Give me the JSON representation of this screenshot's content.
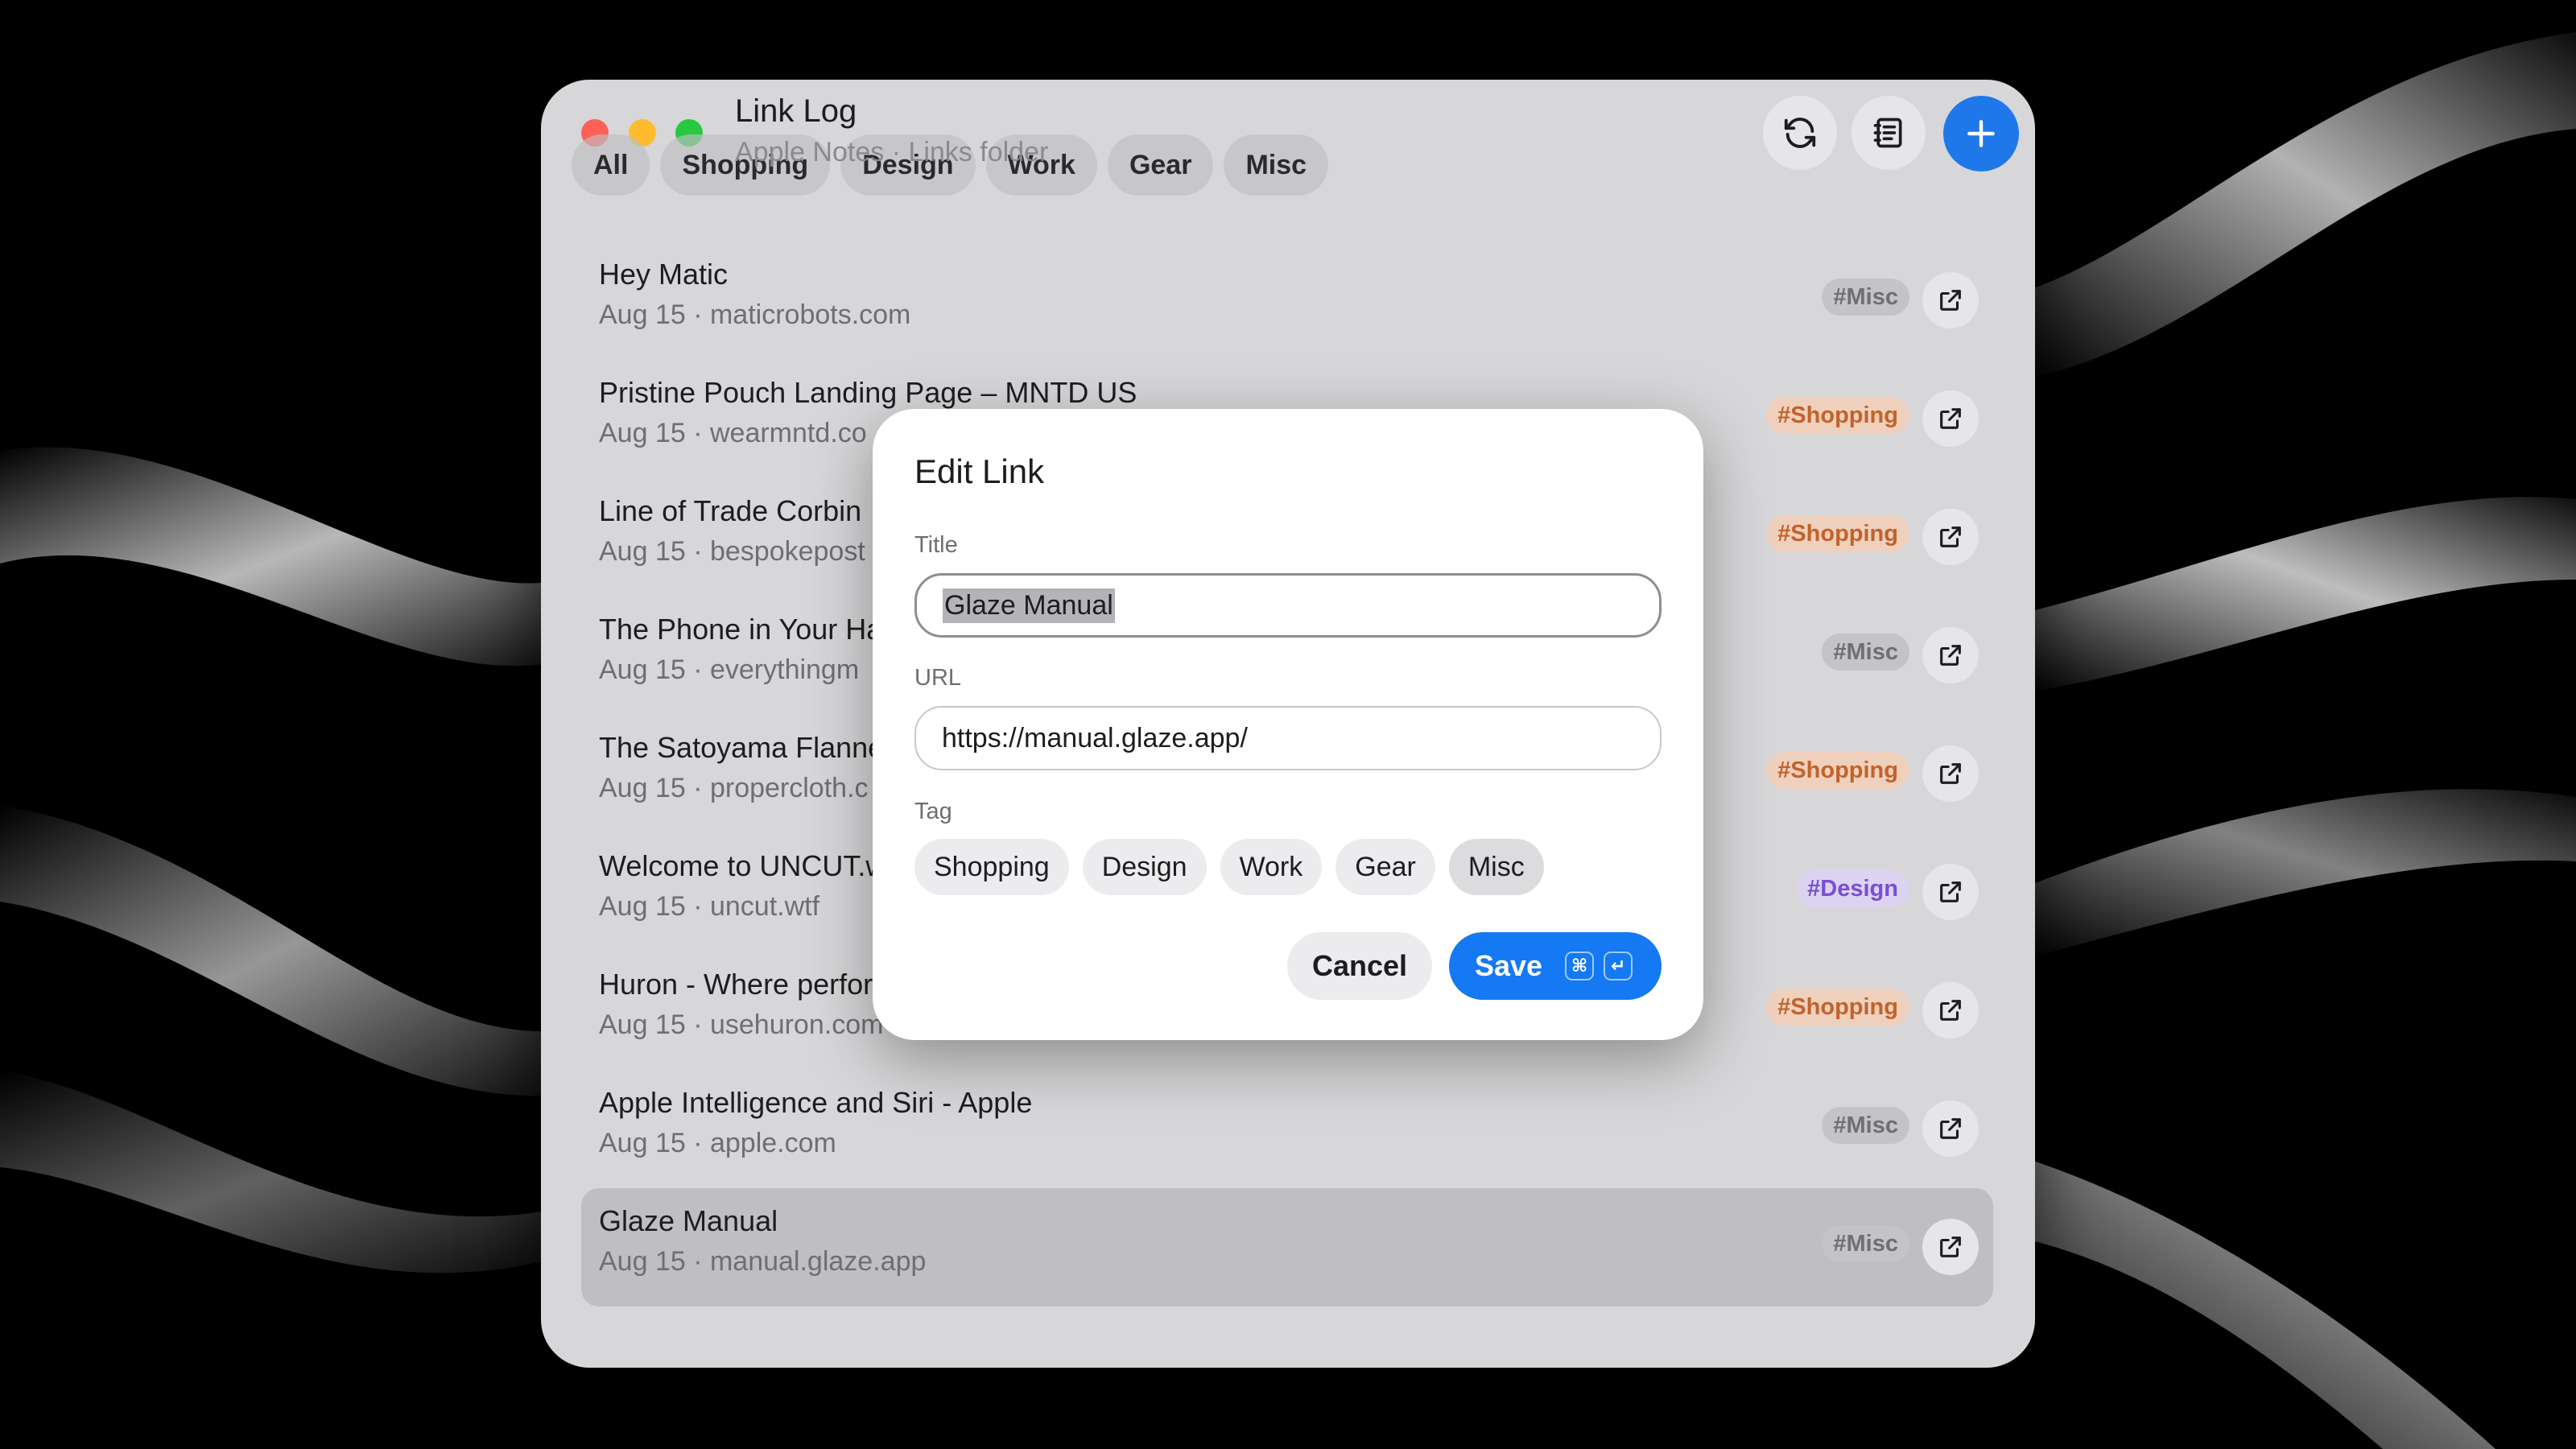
{
  "app": {
    "title": "Link Log",
    "subtitle": "Apple Notes · Links folder"
  },
  "filters": [
    "All",
    "Shopping",
    "Design",
    "Work",
    "Gear",
    "Misc"
  ],
  "toolbar": {
    "refresh_icon": "refresh-icon",
    "notes_icon": "notes-icon",
    "add_icon": "plus-icon",
    "accent": "#1e78ea"
  },
  "links": [
    {
      "title": "Hey Matic",
      "meta": "Aug 15 · maticrobots.com",
      "tag": "#Misc",
      "tag_type": "misc"
    },
    {
      "title": "Pristine Pouch Landing Page – MNTD US",
      "meta": "Aug 15 · wearmntd.co",
      "tag": "#Shopping",
      "tag_type": "shopping"
    },
    {
      "title": "Line of Trade Corbin",
      "meta": "Aug 15 · bespokepost",
      "tag": "#Shopping",
      "tag_type": "shopping"
    },
    {
      "title": "The Phone in Your Ha",
      "meta": "Aug 15 · everythingm",
      "tag": "#Misc",
      "tag_type": "misc"
    },
    {
      "title": "The Satoyama Flanne",
      "meta": "Aug 15 · propercloth.c",
      "tag": "#Shopping",
      "tag_type": "shopping"
    },
    {
      "title": "Welcome to UNCUT.w",
      "meta": "Aug 15 · uncut.wtf",
      "tag": "#Design",
      "tag_type": "design"
    },
    {
      "title": "Huron - Where perfor",
      "meta": "Aug 15 · usehuron.com",
      "tag": "#Shopping",
      "tag_type": "shopping"
    },
    {
      "title": "Apple Intelligence and Siri - Apple",
      "meta": "Aug 15 · apple.com",
      "tag": "#Misc",
      "tag_type": "misc"
    },
    {
      "title": "Glaze Manual",
      "meta": "Aug 15 · manual.glaze.app",
      "tag": "#Misc",
      "tag_type": "misc",
      "selected": true
    }
  ],
  "modal": {
    "title": "Edit Link",
    "title_label": "Title",
    "title_value": "Glaze Manual",
    "url_label": "URL",
    "url_value": "https://manual.glaze.app/",
    "tag_label": "Tag",
    "tag_options": [
      "Shopping",
      "Design",
      "Work",
      "Gear",
      "Misc"
    ],
    "selected_tag": "Misc",
    "cancel_label": "Cancel",
    "save_label": "Save",
    "save_shortcut": [
      "⌘",
      "↵"
    ]
  },
  "colors": {
    "shopping_tag": "#c2622a",
    "design_tag": "#7a4dd6",
    "misc_tag": "#6e6e73",
    "save_button": "#1479f2"
  }
}
